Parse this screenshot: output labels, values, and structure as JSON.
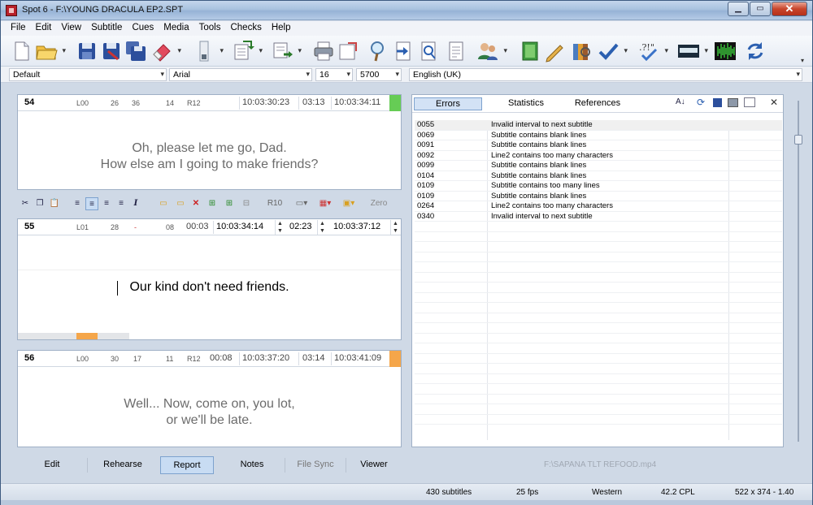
{
  "window": {
    "title": "Spot 6 - F:\\YOUNG DRACULA EP2.SPT"
  },
  "menu": [
    "File",
    "Edit",
    "View",
    "Subtitle",
    "Cues",
    "Media",
    "Tools",
    "Checks",
    "Help"
  ],
  "format": {
    "style": "Default",
    "font": "Arial",
    "size": "16",
    "value": "5700",
    "language": "English (UK)"
  },
  "panels": [
    {
      "num": "54",
      "l": "L00",
      "a": "26",
      "b": "36",
      "c": "14",
      "r": "R12",
      "in": "10:03:30:23",
      "dur": "03:13",
      "out": "10:03:34:11",
      "lines": [
        "Oh, please let me go, Dad.",
        "How else am I going to make friends?"
      ]
    },
    {
      "num": "55",
      "l": "L01",
      "a": "28",
      "b": "-",
      "c": "08",
      "gap": "00:03",
      "in": "10:03:34:14",
      "dur": "02:23",
      "out": "10:03:37:12",
      "lines": [
        "Our kind don't need friends."
      ]
    },
    {
      "num": "56",
      "l": "L00",
      "a": "30",
      "b": "17",
      "c": "11",
      "r": "R12",
      "gap": "00:08",
      "in": "10:03:37:20",
      "dur": "03:14",
      "out": "10:03:41:09",
      "lines": [
        "Well... Now, come on, you lot,",
        "or we'll be late."
      ]
    }
  ],
  "fstrip": {
    "r": "R10",
    "zero": "Zero"
  },
  "right": {
    "tabs": [
      "Errors",
      "Statistics",
      "References"
    ],
    "errors": [
      {
        "code": "0055",
        "desc": "Invalid interval to next subtitle"
      },
      {
        "code": "0069",
        "desc": "Subtitle contains blank lines"
      },
      {
        "code": "0091",
        "desc": "Subtitle contains blank lines"
      },
      {
        "code": "0092",
        "desc": "Line2 contains too many characters"
      },
      {
        "code": "0099",
        "desc": "Subtitle contains blank lines"
      },
      {
        "code": "0104",
        "desc": "Subtitle contains blank lines"
      },
      {
        "code": "0109",
        "desc": "Subtitle contains too many lines"
      },
      {
        "code": "0109",
        "desc": "Subtitle contains blank lines"
      },
      {
        "code": "0264",
        "desc": "Line2 contains too many characters"
      },
      {
        "code": "0340",
        "desc": "Invalid interval to next subtitle"
      }
    ]
  },
  "bottom_tabs": [
    "Edit",
    "Rehearse",
    "Report",
    "Notes",
    "File Sync",
    "Viewer"
  ],
  "media_file": "F:\\SAPANA TLT REFOOD.mp4",
  "status": {
    "subtitles": "430 subtitles",
    "fps": "25 fps",
    "encoding": "Western",
    "cpl": "42.2 CPL",
    "res": "522 x 374 - 1.40"
  },
  "colors": {
    "active_green": "#66cc55",
    "orange": "#f5a64a",
    "tab_active": "#d3e2f5"
  }
}
